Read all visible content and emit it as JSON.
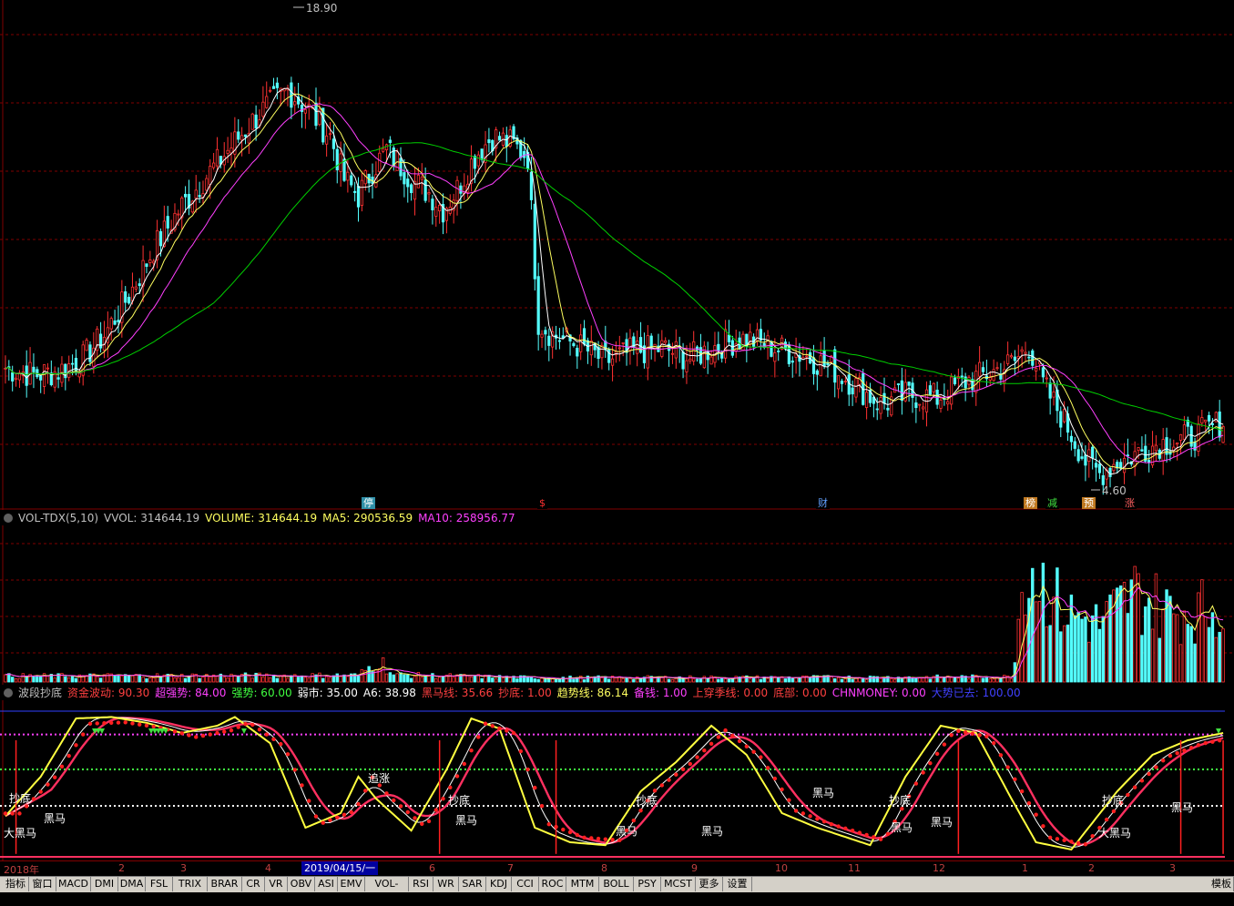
{
  "price_panel": {
    "high_label": "18.90",
    "low_label": "4.60",
    "markers": [
      {
        "text": "停",
        "bg": "#2e8fa8",
        "fg": "#ffffff"
      },
      {
        "text": "$",
        "bg": "#000000",
        "fg": "#ff3030"
      },
      {
        "text": "财",
        "bg": "#000000",
        "fg": "#60a0ff"
      },
      {
        "text": "榜",
        "bg": "#c07820",
        "fg": "#ffffff"
      },
      {
        "text": "减",
        "bg": "#000000",
        "fg": "#40e040"
      },
      {
        "text": "预",
        "bg": "#c07820",
        "fg": "#ffffff"
      },
      {
        "text": "涨",
        "bg": "#000000",
        "fg": "#ff6060"
      }
    ]
  },
  "volume_header": {
    "name": "VOL-TDX(5,10)",
    "items": [
      {
        "text": "VVOL: 314644.19",
        "color": "#c0c0c0"
      },
      {
        "text": "VOLUME: 314644.19",
        "color": "#ffff60"
      },
      {
        "text": "MA5: 290536.59",
        "color": "#ffff60"
      },
      {
        "text": "MA10: 258956.77",
        "color": "#ff40ff"
      }
    ]
  },
  "indicator_header": {
    "name": "波段抄底",
    "items": [
      {
        "text": "资金波动: 90.30",
        "color": "#ff4040"
      },
      {
        "text": "超强势: 84.00",
        "color": "#ff40ff"
      },
      {
        "text": "强势: 60.00",
        "color": "#40ff40"
      },
      {
        "text": "弱市: 35.00",
        "color": "#ffffff"
      },
      {
        "text": "A6: 38.98",
        "color": "#ffffff"
      },
      {
        "text": "黑马线: 35.66",
        "color": "#ff4040"
      },
      {
        "text": "抄底: 1.00",
        "color": "#ff4040"
      },
      {
        "text": "趋势线: 86.14",
        "color": "#ffff60"
      },
      {
        "text": "备钱: 1.00",
        "color": "#ff40ff"
      },
      {
        "text": "上穿季线: 0.00",
        "color": "#ff4040"
      },
      {
        "text": "底部: 0.00",
        "color": "#ff4040"
      },
      {
        "text": "CHNMONEY: 0.00",
        "color": "#ff40ff"
      },
      {
        "text": "大势已去: 100.00",
        "color": "#4040ff"
      }
    ],
    "signal_labels": [
      {
        "text": "抄底",
        "color": "#ffffff"
      },
      {
        "text": "黑马",
        "color": "#ffffff"
      },
      {
        "text": "大黑马",
        "color": "#ffffff"
      },
      {
        "text": "追涨",
        "color": "#ffffff"
      }
    ]
  },
  "date_bar": {
    "labels": [
      "2018年",
      "2",
      "3",
      "4",
      "5",
      "6",
      "7",
      "8",
      "9",
      "10",
      "11",
      "12",
      "1",
      "2",
      "3"
    ],
    "selected": "2019/04/15/一"
  },
  "tabs": [
    "指标",
    "窗口",
    "MACD",
    "DMI",
    "DMA",
    "FSL",
    "TRIX",
    "BRAR",
    "CR",
    "VR",
    "OBV",
    "ASI",
    "EMV",
    "VOL-TDX",
    "RSI",
    "WR",
    "SAR",
    "KDJ",
    "CCI",
    "ROC",
    "MTM",
    "BOLL",
    "PSY",
    "MCST",
    "更多",
    "设置",
    "模板"
  ],
  "colors": {
    "up": "#ff3232",
    "down": "#54ffff",
    "ma5": "#ffffff",
    "ma10": "#ffff60",
    "ma20": "#ff40ff",
    "ma60": "#00d000",
    "grid": "#800000"
  },
  "chart_data": [
    {
      "type": "candlestick",
      "title": "",
      "x": [
        "2018-01",
        "2018-02",
        "2018-03",
        "2018-04",
        "2018-05",
        "2018-06",
        "2018-07",
        "2018-08",
        "2018-09",
        "2018-10",
        "2018-11",
        "2018-12",
        "2019-01",
        "2019-02",
        "2019-03"
      ],
      "close_path": [
        [
          0,
          8.2
        ],
        [
          8,
          8.0
        ],
        [
          15,
          8.1
        ],
        [
          22,
          8.5
        ],
        [
          28,
          9.2
        ],
        [
          35,
          10.4
        ],
        [
          42,
          11.8
        ],
        [
          50,
          13.1
        ],
        [
          57,
          14.0
        ],
        [
          64,
          14.9
        ],
        [
          72,
          15.9
        ],
        [
          80,
          16.6
        ],
        [
          86,
          16.0
        ],
        [
          92,
          15.2
        ],
        [
          96,
          13.9
        ],
        [
          100,
          13.4
        ],
        [
          104,
          14.2
        ],
        [
          108,
          14.8
        ],
        [
          112,
          14.3
        ],
        [
          116,
          13.8
        ],
        [
          120,
          13.5
        ],
        [
          124,
          13.0
        ],
        [
          128,
          13.6
        ],
        [
          133,
          14.6
        ],
        [
          138,
          15.2
        ],
        [
          143,
          15.0
        ],
        [
          148,
          14.6
        ],
        [
          151,
          9.6
        ],
        [
          155,
          9.2
        ],
        [
          162,
          8.9
        ],
        [
          170,
          8.4
        ],
        [
          178,
          8.7
        ],
        [
          186,
          8.8
        ],
        [
          194,
          8.5
        ],
        [
          202,
          8.9
        ],
        [
          210,
          9.1
        ],
        [
          218,
          8.8
        ],
        [
          226,
          8.6
        ],
        [
          234,
          8.2
        ],
        [
          242,
          7.6
        ],
        [
          248,
          7.1
        ],
        [
          256,
          7.4
        ],
        [
          264,
          7.3
        ],
        [
          272,
          7.8
        ],
        [
          280,
          8.1
        ],
        [
          286,
          8.4
        ],
        [
          290,
          8.9
        ],
        [
          294,
          7.7
        ],
        [
          300,
          6.6
        ],
        [
          306,
          5.4
        ],
        [
          310,
          5.0
        ],
        [
          314,
          5.3
        ],
        [
          320,
          5.6
        ],
        [
          326,
          5.9
        ],
        [
          332,
          6.0
        ],
        [
          338,
          6.2
        ],
        [
          345,
          6.6
        ]
      ],
      "n_days": 346,
      "price_range": [
        4.6,
        18.9
      ],
      "high": 18.9,
      "low": 4.6,
      "ma_periods": [
        5,
        10,
        20,
        60
      ]
    },
    {
      "type": "bar",
      "title": "VOL-TDX(5,10)",
      "values_summary": {
        "VVOL": 314644.19,
        "VOLUME": 314644.19,
        "MA5": 290536.59,
        "MA10": 258956.77
      },
      "ylim": [
        0,
        620000
      ],
      "volume_path": [
        [
          0,
          25000
        ],
        [
          100,
          28000
        ],
        [
          106,
          95000
        ],
        [
          110,
          30000
        ],
        [
          150,
          18000
        ],
        [
          250,
          20000
        ],
        [
          285,
          22000
        ],
        [
          289,
          530000
        ],
        [
          300,
          300000
        ],
        [
          310,
          250000
        ],
        [
          320,
          380000
        ],
        [
          330,
          300000
        ],
        [
          345,
          314644
        ]
      ]
    },
    {
      "type": "line",
      "title": "波段抄底",
      "ylim": [
        0,
        105
      ],
      "levels": {
        "超强势": 84.0,
        "强势": 60.0,
        "弱市": 35.0,
        "大势已去": 100.0
      },
      "trend_path": [
        [
          0,
          28
        ],
        [
          10,
          55
        ],
        [
          20,
          95
        ],
        [
          30,
          96
        ],
        [
          40,
          92
        ],
        [
          50,
          85
        ],
        [
          60,
          90
        ],
        [
          65,
          96
        ],
        [
          75,
          78
        ],
        [
          85,
          20
        ],
        [
          95,
          30
        ],
        [
          100,
          55
        ],
        [
          105,
          40
        ],
        [
          115,
          18
        ],
        [
          125,
          60
        ],
        [
          132,
          95
        ],
        [
          140,
          88
        ],
        [
          150,
          20
        ],
        [
          160,
          10
        ],
        [
          170,
          8
        ],
        [
          180,
          45
        ],
        [
          190,
          65
        ],
        [
          200,
          90
        ],
        [
          210,
          70
        ],
        [
          220,
          30
        ],
        [
          230,
          20
        ],
        [
          245,
          8
        ],
        [
          255,
          55
        ],
        [
          265,
          90
        ],
        [
          275,
          85
        ],
        [
          285,
          40
        ],
        [
          292,
          10
        ],
        [
          302,
          5
        ],
        [
          315,
          45
        ],
        [
          325,
          70
        ],
        [
          335,
          80
        ],
        [
          345,
          85
        ]
      ]
    }
  ]
}
